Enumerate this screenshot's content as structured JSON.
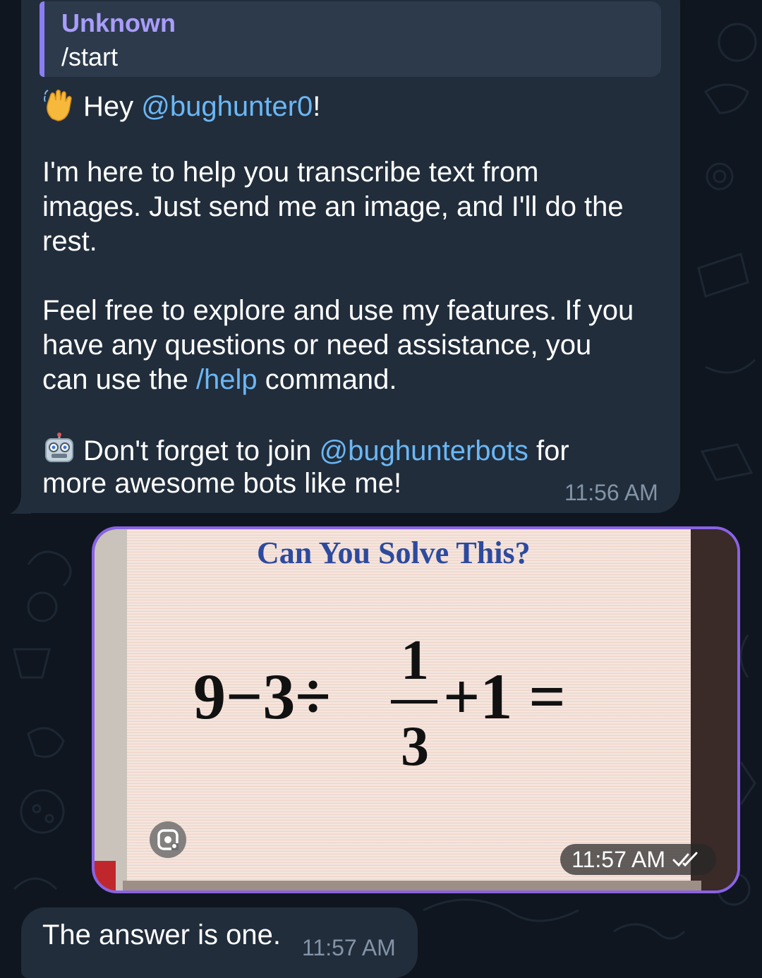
{
  "reply": {
    "name": "Unknown",
    "text": "/start"
  },
  "message1": {
    "greeting_prefix": "Hey ",
    "mention": "@bughunter0",
    "greeting_suffix": "!",
    "para1_line1": "I'm here to help you transcribe text from",
    "para1_line2": "images. Just send me an image, and I'll do the",
    "para1_line3": "rest.",
    "para2_line1": "Feel free to explore and use my features. If you",
    "para2_line2": "have any questions or need assistance, you",
    "para2_line3_prefix": "can use the ",
    "help_command": "/help",
    "para2_line3_suffix": " command.",
    "para3_prefix": "Don't forget to join ",
    "channel": "@bughunterbots",
    "para3_suffix": " for",
    "para3_line2": "more awesome bots like me!",
    "time": "11:56 AM",
    "wave_emoji": "waving-hand-emoji",
    "robot_emoji": "robot-emoji"
  },
  "photo": {
    "title": "Can You Solve This?",
    "expression_left": "9−3÷",
    "fraction_num": "1",
    "fraction_den": "3",
    "expression_right": "+1 =",
    "time": "11:57 AM",
    "status_icon": "double-check-icon",
    "border_color": "#8a62e6"
  },
  "message2": {
    "text": "The answer is one.",
    "time": "11:57 AM"
  },
  "colors": {
    "background": "#0f1620",
    "bubble_incoming": "#212d3b",
    "link": "#6bb7f5",
    "reply_accent": "#8b7ef2",
    "timestamp": "#8494a6"
  }
}
